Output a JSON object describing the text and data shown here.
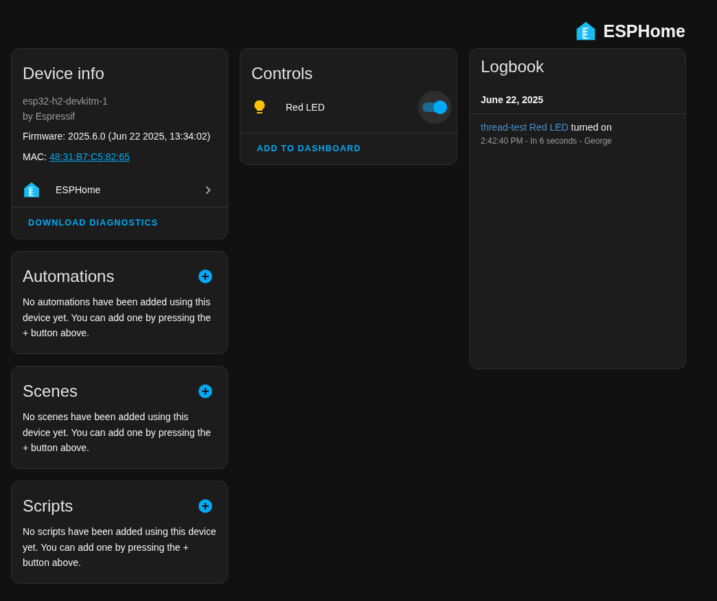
{
  "brand": {
    "name": "ESPHome"
  },
  "device_info": {
    "title": "Device info",
    "model": "esp32-h2-devkitm-1",
    "manufacturer": "by Espressif",
    "firmware": "Firmware: 2025.6.0 (Jun 22 2025, 13:34:02)",
    "mac_label": "MAC:",
    "mac": "48:31:B7:C5:82:65",
    "integration": "ESPHome",
    "action": "DOWNLOAD DIAGNOSTICS"
  },
  "sections": [
    {
      "title": "Automations",
      "text": "No automations have been added using this device yet. You can add one by pressing the + button above."
    },
    {
      "title": "Scenes",
      "text": "No scenes have been added using this device yet. You can add one by pressing the + button above."
    },
    {
      "title": "Scripts",
      "text": "No scripts have been added using this device yet. You can add one by pressing the + button above."
    }
  ],
  "controls": {
    "title": "Controls",
    "entities": [
      {
        "name": "Red LED",
        "on": true
      }
    ],
    "action": "ADD TO DASHBOARD"
  },
  "logbook": {
    "title": "Logbook",
    "date": "June 22, 2025",
    "entries": [
      {
        "entity": "thread-test Red LED",
        "message": "turned on",
        "details": "2:42:40 PM - In 6 seconds - George"
      }
    ]
  }
}
